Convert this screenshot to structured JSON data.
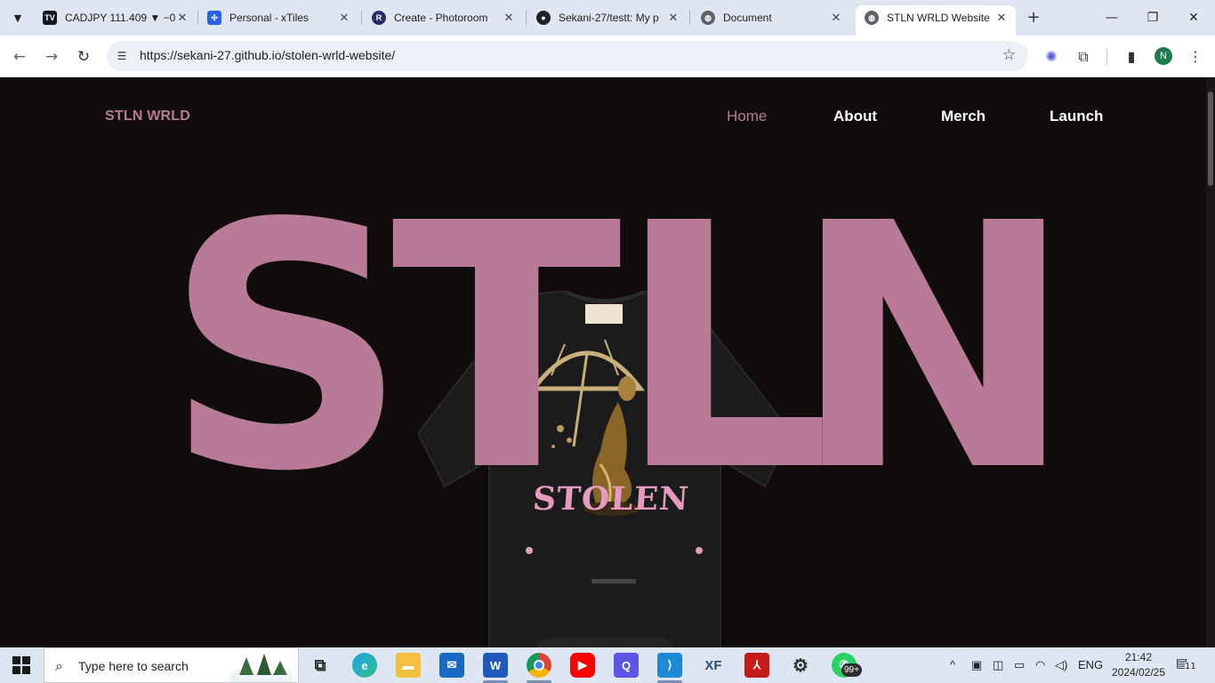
{
  "browser": {
    "tabs": [
      {
        "label": "CADJPY 111.409 ▼ −0.",
        "favicon": "tradingview-icon",
        "color": "#131722"
      },
      {
        "label": "Personal - xTiles",
        "favicon": "xtiles-icon",
        "color": "#2a62e8"
      },
      {
        "label": "Create - Photoroom",
        "favicon": "photoroom-icon",
        "color": "#2b2b6a"
      },
      {
        "label": "Sekani-27/testt: My p",
        "favicon": "github-icon",
        "color": "#1f2328"
      },
      {
        "label": "Document",
        "favicon": "globe-icon",
        "color": "#5f6368"
      },
      {
        "label": "STLN WRLD Website",
        "favicon": "globe-icon",
        "color": "#5f6368",
        "active": true
      }
    ],
    "url": "https://sekani-27.github.io/stolen-wrld-website/",
    "profile_initial": "N"
  },
  "site": {
    "brand": "STLN WRLD",
    "nav": [
      "Home",
      "About",
      "Merch",
      "Launch"
    ],
    "current_nav": "Home",
    "hero_letters": [
      "S",
      "T",
      "L",
      "N"
    ],
    "shirt_print_text": "STOLEN",
    "accent_color": "#b97a97",
    "background_color": "#0f0c0b"
  },
  "taskbar": {
    "search_placeholder": "Type here to search",
    "apps": [
      "task-view-icon",
      "edge-icon",
      "file-explorer-icon",
      "mail-icon",
      "word-icon",
      "chrome-icon",
      "youtube-icon",
      "q-app-icon",
      "vscode-icon",
      "xf-app-icon",
      "acrobat-icon",
      "settings-icon",
      "whatsapp-icon"
    ],
    "whatsapp_badge": "99+",
    "language": "ENG",
    "time": "21:42",
    "date": "2024/02/25",
    "notification_count": "11"
  }
}
